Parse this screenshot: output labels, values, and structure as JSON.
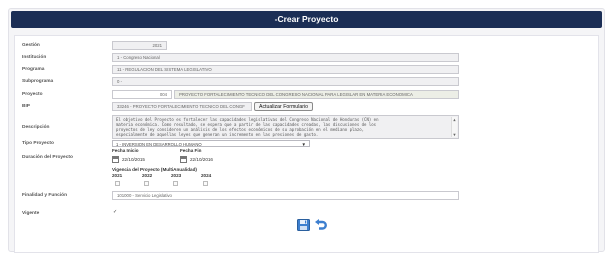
{
  "header": {
    "title": "-Crear Proyecto"
  },
  "form": {
    "gestion": {
      "label": "Gestión",
      "value": "2021"
    },
    "institucion": {
      "label": "Institución",
      "value": "1 - Congreso Nacional"
    },
    "programa": {
      "label": "Programa",
      "value": "11 - REGULACION DEL SISTEMA LEGISLATIVO"
    },
    "subprograma": {
      "label": "Subprograma",
      "value": "0 -"
    },
    "proyecto": {
      "label": "Proyecto",
      "code": "004",
      "name": "PROYECTO FORTALECIMIENTO TECNICO DEL CONGRESO NACIONAL PARA LEGISLAR EN MATERIA ECONOMICA"
    },
    "bip": {
      "label": "BIP",
      "value": "33246 - PROYECTO FORTALECIMIENTO TECNICO DEL CONGF",
      "button": "Actualizar Formulario"
    },
    "descripcion": {
      "label": "Descripción",
      "lines": [
        "El objetivo del Proyecto es fortalecer las capacidades legislativas del Congreso Nacional de Honduras (CN) en",
        "materia económica. Como resultado, se espera que a partir de las capacidades creadas, las discusiones de los",
        "proyectos de ley consideren un análisis de los efectos económicos de su aprobación en el mediano plazo,",
        "especialmente de aquellas leyes que generan un incremento en las presiones de gasto."
      ]
    },
    "tipo_proyecto": {
      "label": "Tipo Proyecto",
      "value": "1 - INVERSION EN DESARROLLO HUMANO"
    },
    "duracion": {
      "label": "Duración del Proyecto",
      "fecha_inicio_label": "Fecha Inicio",
      "fecha_inicio": "22/10/2015",
      "fecha_fin_label": "Fecha Fin",
      "fecha_fin": "22/10/2016"
    },
    "vigencia": {
      "label": "Vigencia del Proyecto (MultiAnualidad)",
      "years": [
        "2021",
        "2022",
        "2023",
        "2024"
      ]
    },
    "finalidad": {
      "label": "Finalidad y Función",
      "value": "101000 - Servicio Legislativo"
    },
    "vigente": {
      "label": "Vigente",
      "check": "✓"
    }
  },
  "actions": {
    "save_icon": "floppy-save-icon",
    "undo_icon": "undo-arrow-icon"
  },
  "colors": {
    "header_bg": "#1b2e55",
    "icon_blue": "#3d7fcf"
  }
}
